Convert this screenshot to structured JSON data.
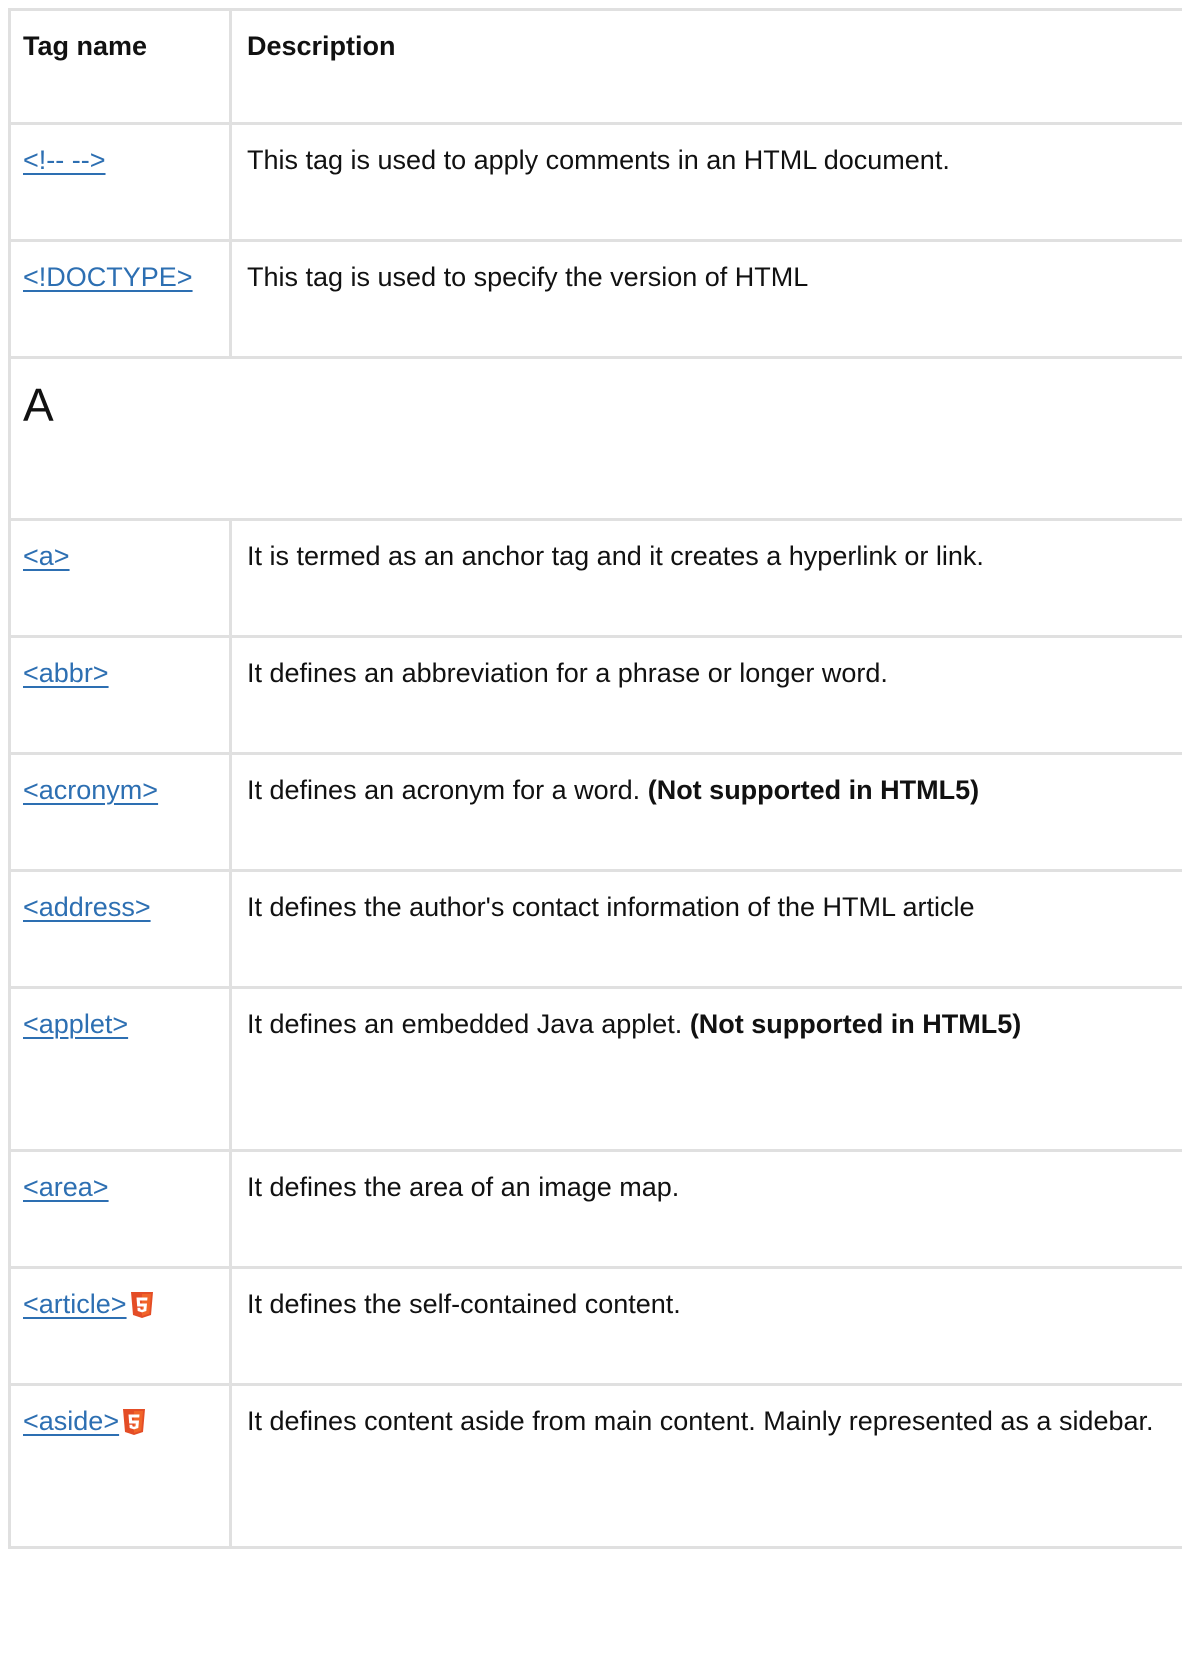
{
  "table": {
    "headers": {
      "col1": "Tag name",
      "col2": "Description"
    },
    "rows_top": [
      {
        "tag": "<!-- -->",
        "description": "This tag is used to apply comments in an HTML document.",
        "note": "",
        "html5": false
      },
      {
        "tag": "<!DOCTYPE>",
        "description": "This tag is used to specify the version of HTML",
        "note": "",
        "html5": false
      }
    ],
    "section_letter": "A",
    "rows_a": [
      {
        "tag": "<a>",
        "description": "It is termed as an anchor tag and it creates a hyperlink or link.",
        "note": "",
        "html5": false
      },
      {
        "tag": "<abbr>",
        "description": "It defines an abbreviation for a phrase or longer word.",
        "note": "",
        "html5": false
      },
      {
        "tag": "<acronym>",
        "description": "It defines an acronym for a word. ",
        "note": "(Not supported in HTML5)",
        "html5": false
      },
      {
        "tag": "<address>",
        "description": "It defines the author's contact information of the HTML article",
        "note": "",
        "html5": false
      },
      {
        "tag": "<applet>",
        "description": "It defines an embedded Java applet. ",
        "note": "(Not supported in HTML5)",
        "html5": false
      },
      {
        "tag": "<area>",
        "description": "It defines the area of an image map.",
        "note": "",
        "html5": false
      },
      {
        "tag": "<article>",
        "description": "It defines the self-contained content.",
        "note": "",
        "html5": true
      },
      {
        "tag": "<aside>",
        "description": "It defines content aside from main content. Mainly represented as a sidebar.",
        "note": "",
        "html5": true
      }
    ]
  },
  "colors": {
    "link": "#2d6fb2",
    "border": "#e0e0e0",
    "html5_badge": "#e44d26"
  },
  "icons": {
    "html5": "html5-icon"
  }
}
